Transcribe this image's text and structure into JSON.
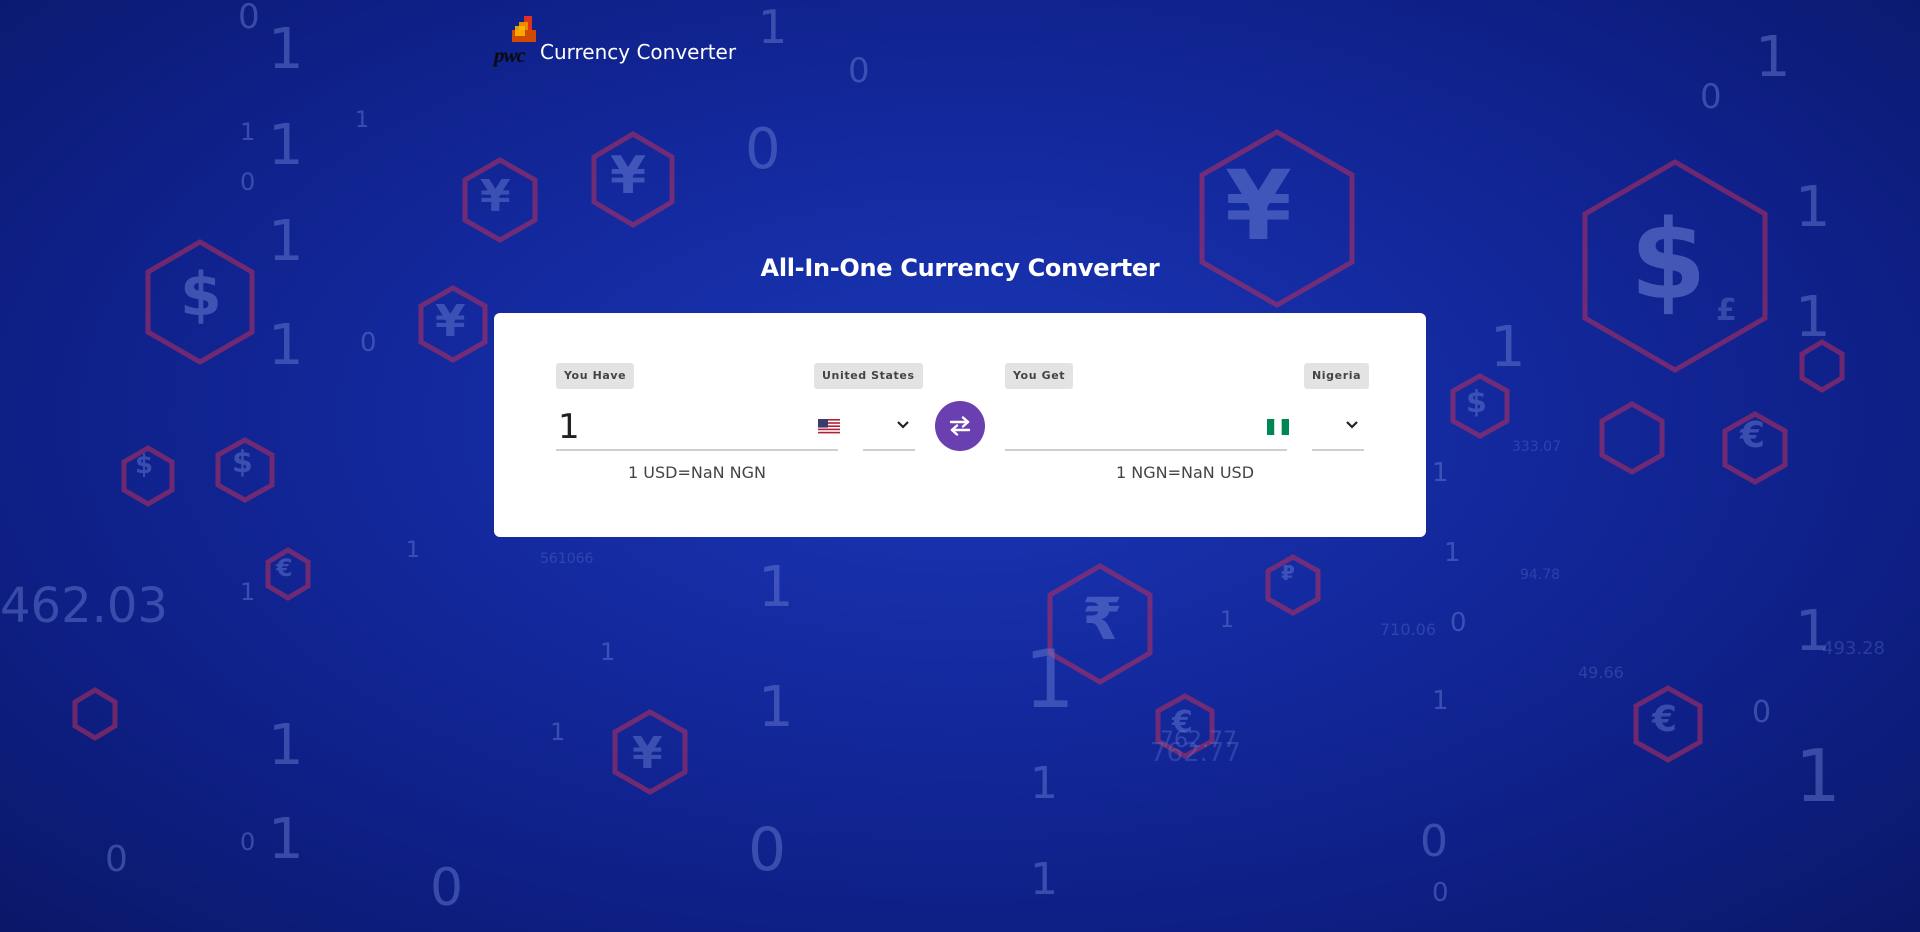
{
  "brand": {
    "logo_text": "pwc",
    "title": "Currency Converter"
  },
  "heading": "All-In-One Currency Converter",
  "converter": {
    "from": {
      "tag": "You Have",
      "country": "United States",
      "amount": "1",
      "flag": "us-flag-icon",
      "rate": "1 USD=NaN NGN"
    },
    "to": {
      "tag": "You Get",
      "country": "Nigeria",
      "amount": "",
      "flag": "nigeria-flag-icon",
      "rate": "1 NGN=NaN USD"
    },
    "swap_icon": "swap-arrows-icon"
  },
  "background": {
    "digits": [
      "0",
      "1",
      "462.03",
      "762.77",
      "493.28",
      "710.06",
      "49.66",
      "333.07",
      "561066",
      "94.78"
    ],
    "currency_symbols": [
      "$",
      "¥",
      "€",
      "₹",
      "£",
      "₽"
    ]
  },
  "colors": {
    "background": "#142aa0",
    "card": "#ffffff",
    "swap_button": "#6a3fb0",
    "tag_bg": "#e3e3e3",
    "hex_outline": "#c0305a"
  }
}
